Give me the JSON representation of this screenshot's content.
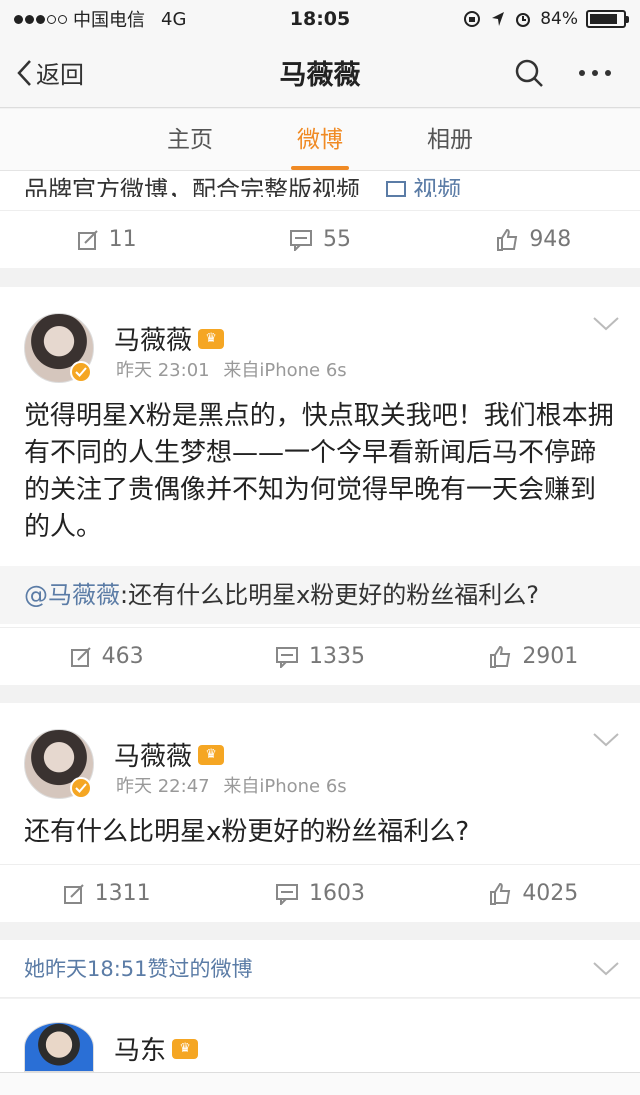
{
  "status_bar": {
    "carrier": "中国电信",
    "network": "4G",
    "time": "18:05",
    "battery": "84%",
    "battery_level": 0.84
  },
  "nav": {
    "back_label": "返回",
    "title": "马薇薇",
    "icons": [
      "search-icon",
      "more-icon"
    ]
  },
  "tabs": [
    {
      "label": "主页"
    },
    {
      "label": "微博",
      "active": true
    },
    {
      "label": "相册"
    }
  ],
  "partial_post": {
    "text": "品牌官方微博，配合完整版视频",
    "video_label": "视频",
    "actions": {
      "repost": "11",
      "comment": "55",
      "like": "948"
    }
  },
  "posts": [
    {
      "author": "马薇薇",
      "time": "昨天 23:01",
      "source": "来自iPhone 6s",
      "text": "觉得明星X粉是黑点的，快点取关我吧！我们根本拥有不同的人生梦想——一个今早看新闻后马不停蹄的关注了贵偶像并不知为何觉得早晚有一天会赚到的人。",
      "repost_mention": "@马薇薇",
      "repost_text": ":还有什么比明星x粉更好的粉丝福利么?",
      "actions": {
        "repost": "463",
        "comment": "1335",
        "like": "2901"
      }
    },
    {
      "author": "马薇薇",
      "time": "昨天 22:47",
      "source": "来自iPhone 6s",
      "text": "还有什么比明星x粉更好的粉丝福利么?",
      "actions": {
        "repost": "1311",
        "comment": "1603",
        "like": "4025"
      }
    }
  ],
  "liked_section": {
    "header": "她昨天18:51赞过的微博",
    "author": "马东"
  },
  "colors": {
    "accent": "#f08a24",
    "link": "#5b7ca6",
    "verified": "#f5a623"
  }
}
